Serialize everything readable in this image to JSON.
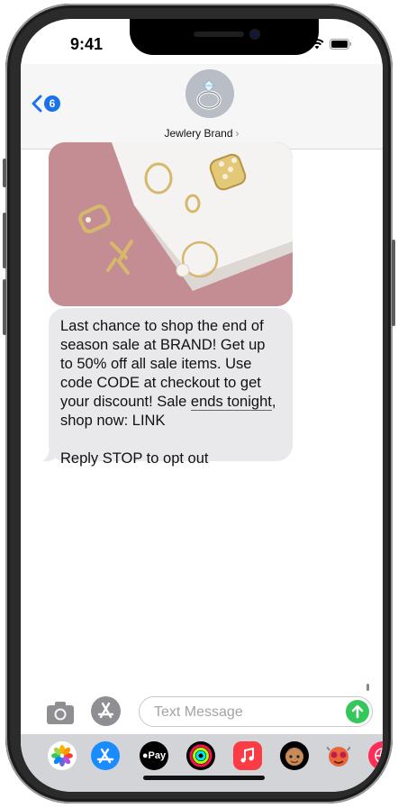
{
  "status_bar": {
    "time": "9:41"
  },
  "header": {
    "back_count": "6",
    "contact_name": "Jewlery Brand",
    "contact_chevron": "›"
  },
  "message": {
    "line1": "Last chance to shop the end of season sale at BRAND! Get up to 50% off all sale items. Use code CODE at checkout to get your discount! Sale ",
    "underlined": "ends tonight",
    "line2": ", shop now: LINK",
    "optout": "Reply STOP to opt out"
  },
  "compose": {
    "placeholder": "Text Message"
  },
  "app_drawer": {
    "items": [
      "photos-icon",
      "app-store-icon",
      "apple-pay-icon",
      "activity-icon",
      "music-icon",
      "memoji-icon",
      "animoji-icon",
      "web-images-icon"
    ],
    "apple_pay_label": "Pay"
  },
  "colors": {
    "accent": "#1a73e8",
    "bubble": "#e9e9eb",
    "send": "#34c759"
  }
}
